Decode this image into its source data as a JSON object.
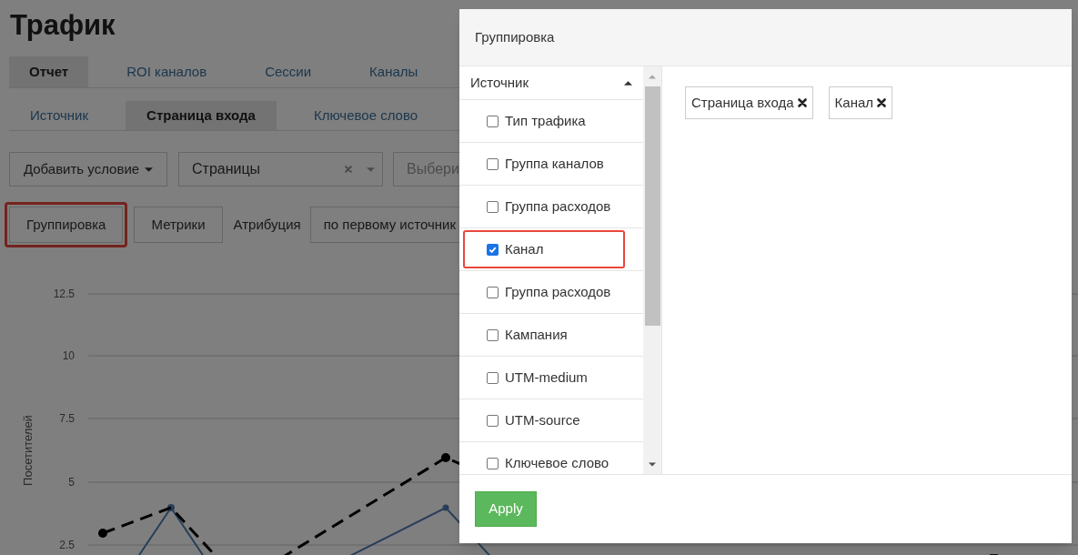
{
  "page": {
    "title": "Трафик"
  },
  "tabs": [
    {
      "label": "Отчет",
      "selected": true
    },
    {
      "label": "ROI каналов",
      "selected": false
    },
    {
      "label": "Сессии",
      "selected": false
    },
    {
      "label": "Каналы",
      "selected": false
    }
  ],
  "subtabs": [
    {
      "label": "Источник",
      "selected": false
    },
    {
      "label": "Страница входа",
      "selected": true
    },
    {
      "label": "Ключевое слово",
      "selected": false
    }
  ],
  "filters": {
    "add_condition": "Добавить условие",
    "pages_select": "Страницы",
    "third_select": "Выбери"
  },
  "actions": [
    {
      "label": "Группировка",
      "highlighted": true
    },
    {
      "label": "Метрики",
      "highlighted": false
    }
  ],
  "attribution": {
    "label": "Атрибуция",
    "value": "по первому источник"
  },
  "chart": {
    "ylabel": "Посетителей",
    "yticks": [
      "12.5",
      "10",
      "7.5",
      "5",
      "2.5"
    ]
  },
  "dialog": {
    "title": "Группировка",
    "group": {
      "label": "Источник",
      "expanded": true,
      "items": [
        {
          "label": "Тип трафика",
          "checked": false,
          "highlighted": false
        },
        {
          "label": "Группа каналов",
          "checked": false,
          "highlighted": false
        },
        {
          "label": "Группа расходов",
          "checked": false,
          "highlighted": false
        },
        {
          "label": "Канал",
          "checked": true,
          "highlighted": true
        },
        {
          "label": "Группа расходов",
          "checked": false,
          "highlighted": false
        },
        {
          "label": "Кампания",
          "checked": false,
          "highlighted": false
        },
        {
          "label": "UTM-medium",
          "checked": false,
          "highlighted": false
        },
        {
          "label": "UTM-source",
          "checked": false,
          "highlighted": false
        },
        {
          "label": "Ключевое слово",
          "checked": false,
          "highlighted": false
        }
      ]
    },
    "tags": [
      "Страница входа",
      "Канал"
    ],
    "apply": "Apply"
  }
}
